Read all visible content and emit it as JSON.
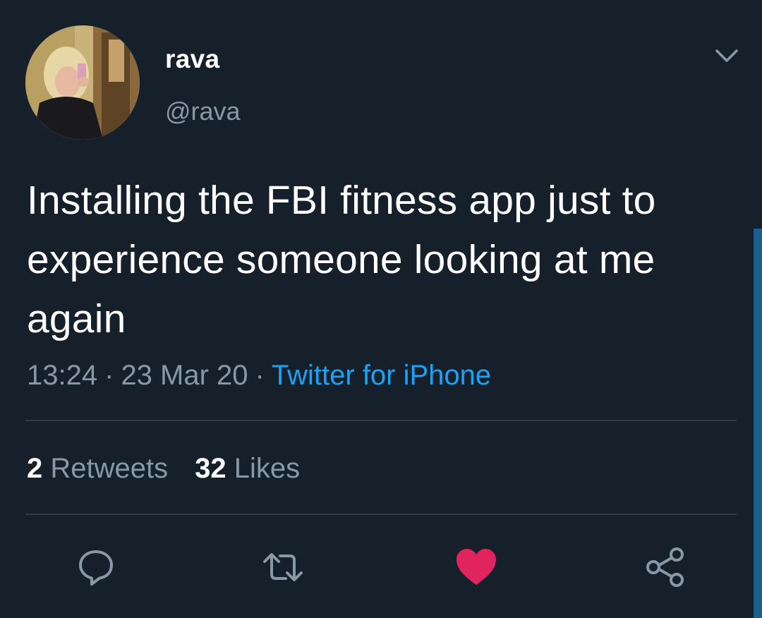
{
  "user": {
    "display_name": "rava",
    "handle": "@rava"
  },
  "tweet": {
    "text": "Installing the FBI fitness app just to experience someone looking at me again",
    "time": "13:24",
    "date": "23 Mar 20",
    "separator": "·",
    "source": "Twitter for iPhone"
  },
  "stats": {
    "retweets_count": "2",
    "retweets_label": "Retweets",
    "likes_count": "32",
    "likes_label": "Likes"
  },
  "actions": {
    "reply_icon": "reply-bubble-icon",
    "retweet_icon": "retweet-icon",
    "like_icon": "heart-icon",
    "share_icon": "share-icon",
    "like_active": true
  },
  "colors": {
    "background": "#15202b",
    "secondary_text": "#8899a6",
    "accent": "#1da1f2",
    "like": "#e0245e",
    "divider": "#2f3d4b"
  }
}
